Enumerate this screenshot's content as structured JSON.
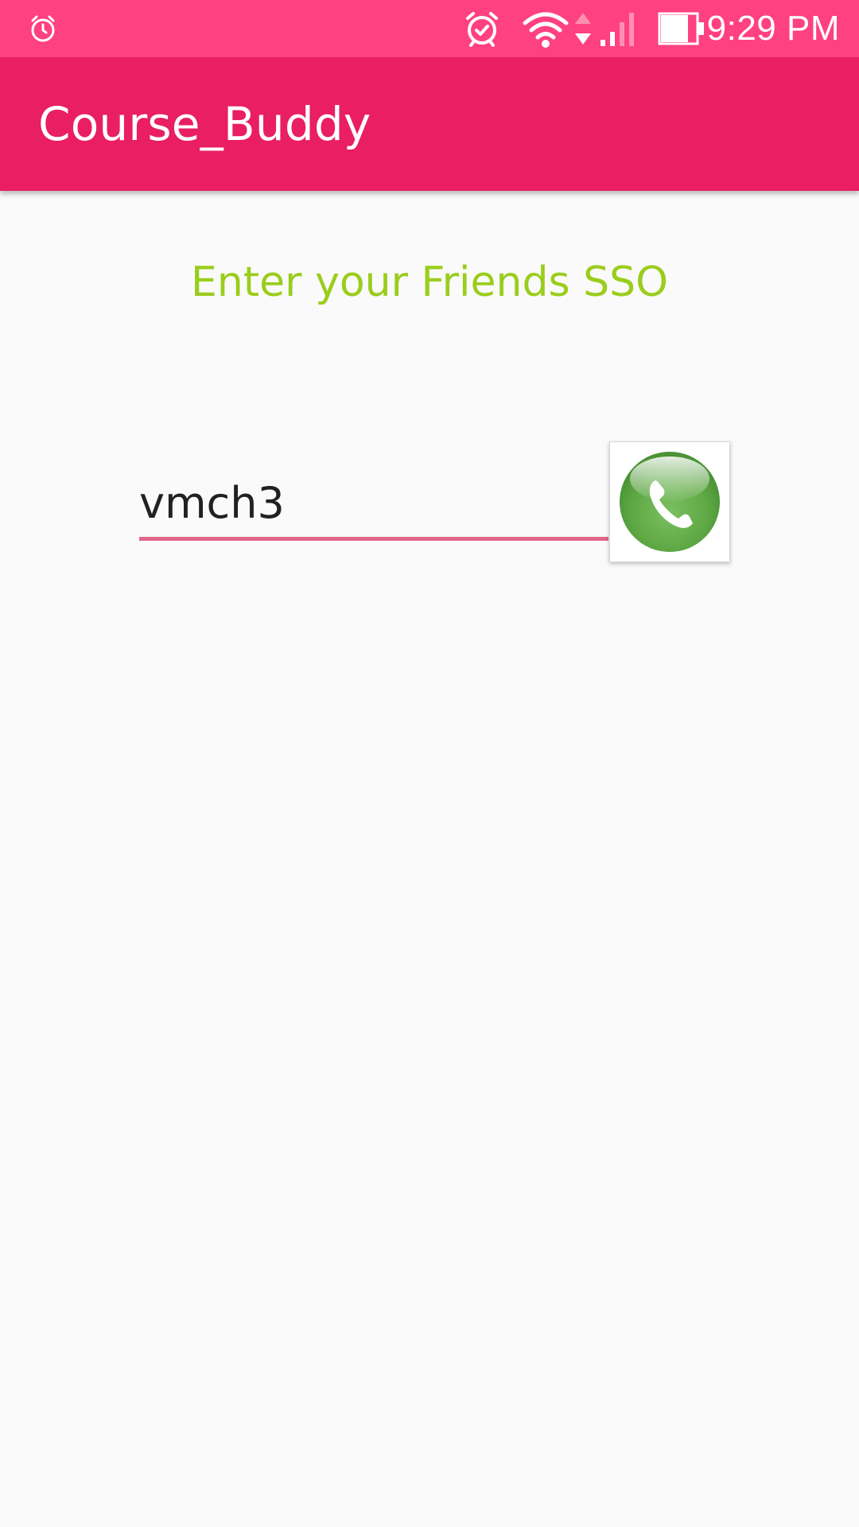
{
  "status_bar": {
    "time": "9:29 PM",
    "icons": [
      "alarm-clock-icon",
      "alarm-icon",
      "wifi-icon",
      "data-arrows-icon",
      "signal-icon",
      "battery-icon"
    ]
  },
  "app_bar": {
    "title": "Course_Buddy",
    "color": "#e91e63"
  },
  "main": {
    "prompt": "Enter your Friends SSO",
    "prompt_color": "#9acd1c",
    "sso_input": {
      "value": "vmch3",
      "underline_color": "#e0668a"
    },
    "call_button": {
      "icon": "phone-icon"
    }
  }
}
